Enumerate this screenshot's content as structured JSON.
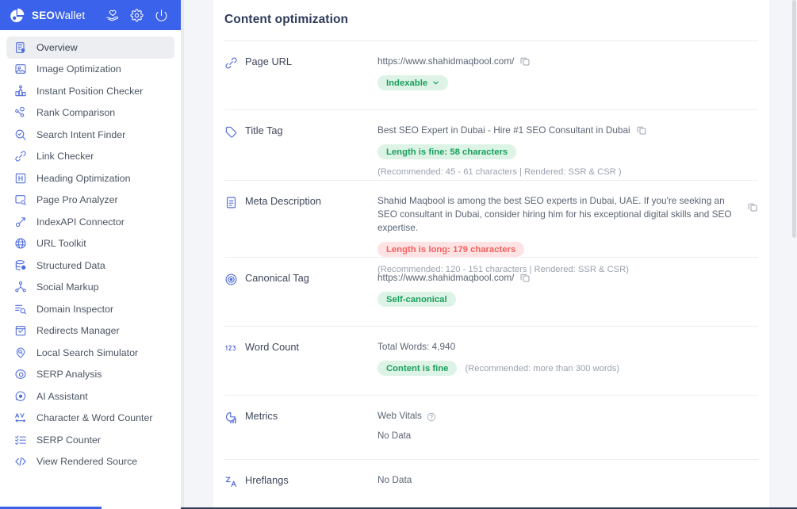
{
  "brand": {
    "logo_icon": "pie-chart-logo-icon",
    "name_bold": "SEO",
    "name_rest": "Wallet",
    "actions": [
      {
        "icon": "hand-heart-icon",
        "name": "support-icon"
      },
      {
        "icon": "gear-icon",
        "name": "settings-icon"
      },
      {
        "icon": "power-icon",
        "name": "logout-icon"
      }
    ],
    "bar_color": "#3b62ea"
  },
  "sidebar": {
    "items": [
      {
        "label": "Overview",
        "icon": "overview-icon",
        "active": true
      },
      {
        "label": "Image Optimization",
        "icon": "image-icon",
        "active": false
      },
      {
        "label": "Instant Position Checker",
        "icon": "position-icon",
        "active": false
      },
      {
        "label": "Rank Comparison",
        "icon": "rank-icon",
        "active": false
      },
      {
        "label": "Search Intent Finder",
        "icon": "search-check-icon",
        "active": false
      },
      {
        "label": "Link Checker",
        "icon": "link-icon",
        "active": false
      },
      {
        "label": "Heading Optimization",
        "icon": "heading-icon",
        "active": false
      },
      {
        "label": "Page Pro Analyzer",
        "icon": "page-search-icon",
        "active": false
      },
      {
        "label": "IndexAPI Connector",
        "icon": "plug-icon",
        "active": false
      },
      {
        "label": "URL Toolkit",
        "icon": "globe-icon",
        "active": false
      },
      {
        "label": "Structured Data",
        "icon": "database-icon",
        "active": false
      },
      {
        "label": "Social Markup",
        "icon": "share-icon",
        "active": false
      },
      {
        "label": "Domain Inspector",
        "icon": "domain-search-icon",
        "active": false
      },
      {
        "label": "Redirects Manager",
        "icon": "calendar-check-icon",
        "active": false
      },
      {
        "label": "Local Search Simulator",
        "icon": "map-pin-search-icon",
        "active": false
      },
      {
        "label": "SERP Analysis",
        "icon": "serp-circle-icon",
        "active": false
      },
      {
        "label": "AI Assistant",
        "icon": "ai-chat-icon",
        "active": false
      },
      {
        "label": "Character & Word Counter",
        "icon": "char-counter-icon",
        "active": false
      },
      {
        "label": "SERP Counter",
        "icon": "checklist-icon",
        "active": false
      },
      {
        "label": "View Rendered Source",
        "icon": "code-icon",
        "active": false
      }
    ]
  },
  "main": {
    "page_title": "Content optimization",
    "rows": {
      "page_url": {
        "label": "Page URL",
        "icon": "link-icon",
        "value": "https://www.shahidmaqbool.com/",
        "badge": "Indexable",
        "badge_type": "green",
        "has_chevron": true,
        "copy": "copy-icon"
      },
      "title_tag": {
        "label": "Title Tag",
        "icon": "tag-icon",
        "value": "Best SEO Expert in Dubai - Hire #1 SEO Consultant in Dubai",
        "badge": "Length is fine: 58 characters",
        "badge_type": "green",
        "hint": "(Recommended: 45 - 61 characters | Rendered: SSR & CSR )",
        "copy": "copy-icon"
      },
      "meta_description": {
        "label": "Meta Description",
        "icon": "document-icon",
        "value": "Shahid Maqbool is among the best SEO experts in Dubai, UAE. If you're seeking an SEO consultant in Dubai, consider hiring him for his exceptional digital skills and SEO expertise.",
        "badge": "Length is long: 179 characters",
        "badge_type": "red",
        "hint": "(Recommended: 120 - 151 characters | Rendered: SSR & CSR)",
        "copy": "copy-icon"
      },
      "canonical_tag": {
        "label": "Canonical Tag",
        "icon": "target-icon",
        "value": "https://www.shahidmaqbool.com/",
        "badge": "Self-canonical",
        "badge_type": "green",
        "copy": "copy-icon"
      },
      "word_count": {
        "label": "Word Count",
        "icon": "numbers-icon",
        "value": "Total Words: 4,940",
        "badge": "Content is fine",
        "badge_type": "green",
        "hint": "(Recommended: more than 300 words)"
      },
      "metrics": {
        "label": "Metrics",
        "icon": "chart-icon",
        "value": "Web Vitals",
        "help_icon": "question-mark-icon",
        "status": "No Data"
      },
      "hreflangs": {
        "label": "Hreflangs",
        "icon": "translate-icon",
        "status": "No Data"
      }
    }
  },
  "colors": {
    "accent": "#3b62ea",
    "green": "#19a05c",
    "green_bg": "#ddf3e6",
    "red": "#f2615f",
    "red_bg": "#fde3e4",
    "icon_blue": "#5a72d8"
  }
}
